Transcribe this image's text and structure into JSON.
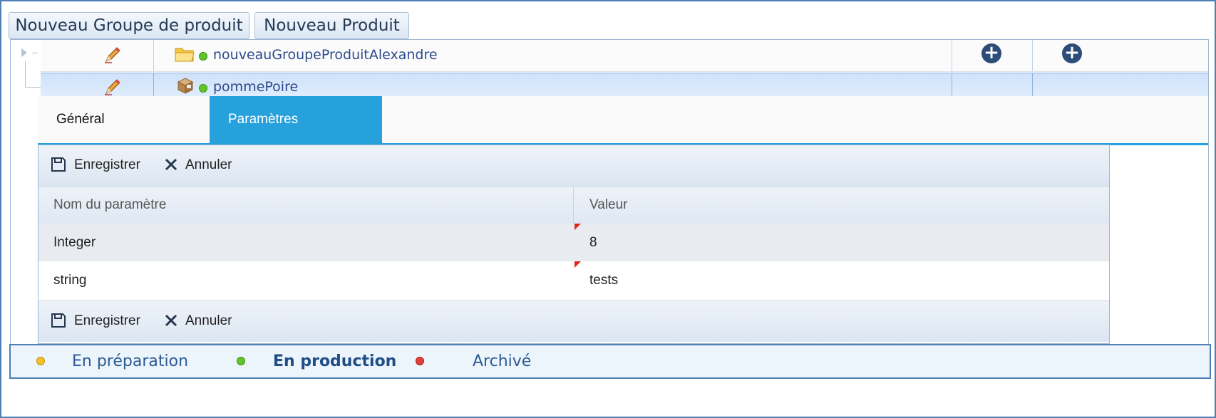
{
  "toolbar": {
    "new_group_label": "Nouveau Groupe de produit",
    "new_product_label": "Nouveau Produit"
  },
  "tree": {
    "rows": [
      {
        "label": "nouveauGroupeProduitAlexandre",
        "type_icon": "folder-icon",
        "status": "En production",
        "status_color": "#62c32c"
      },
      {
        "label": "pommePoire",
        "type_icon": "package-icon",
        "status": "En production",
        "status_color": "#62c32c",
        "selected": true
      }
    ]
  },
  "detail": {
    "tabs": [
      {
        "label": "Général",
        "active": false
      },
      {
        "label": "Paramètres",
        "active": true
      }
    ],
    "actions": {
      "save_label": "Enregistrer",
      "cancel_label": "Annuler"
    },
    "table": {
      "headers": [
        "Nom du paramètre",
        "Valeur"
      ],
      "rows": [
        {
          "name": "Integer",
          "value": "8",
          "modified": true
        },
        {
          "name": "string",
          "value": "tests",
          "modified": true
        }
      ]
    }
  },
  "legend": {
    "items": [
      {
        "label": "En préparation",
        "color": "#f2c12a",
        "bold": false
      },
      {
        "label": "En production",
        "color": "#62c32c",
        "bold": true
      },
      {
        "label": "Archivé",
        "color": "#e04136",
        "bold": false
      }
    ]
  },
  "colors": {
    "accent": "#26a1db",
    "border": "#4f7fb5",
    "selected_row": "#cfe2fa",
    "link_text": "#2e4a8c"
  }
}
